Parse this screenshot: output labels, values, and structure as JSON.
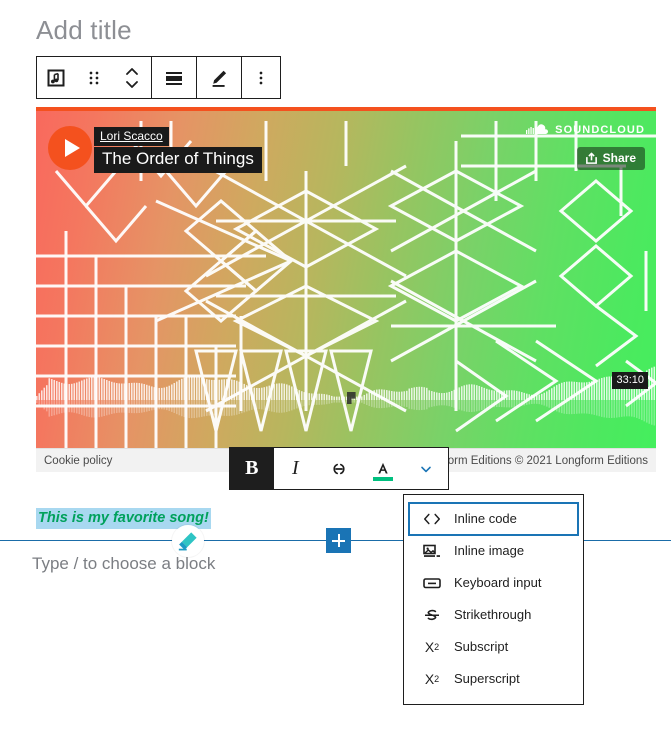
{
  "editor": {
    "title_placeholder": "Add title",
    "block_placeholder": "Type / to choose a block",
    "paragraph_text": "This is my favorite song!"
  },
  "block_toolbar": {
    "items": [
      {
        "name": "audio-block-icon",
        "label": "Audio"
      },
      {
        "name": "drag-handle-icon",
        "label": "Drag"
      },
      {
        "name": "move-updown-icon",
        "label": "Move up or down"
      },
      {
        "name": "align-icon",
        "label": "Change alignment"
      },
      {
        "name": "edit-pencil-icon",
        "label": "Edit"
      },
      {
        "name": "more-options-icon",
        "label": "Options"
      }
    ]
  },
  "embed": {
    "provider": "SOUNDCLOUD",
    "artist": "Lori Scacco",
    "track": "The Order of Things",
    "share_label": "Share",
    "duration": "33:10",
    "cookie_policy": "Cookie policy",
    "copyright": "Longform Editions © 2021 Longform Editions",
    "accent_color": "#f4511e",
    "gradient_start": "#f9695d",
    "gradient_end": "#44ef5d"
  },
  "format_toolbar": {
    "bold_label": "B",
    "italic_label": "I",
    "link_label": "Link",
    "text_color_label": "A",
    "more_label": "More rich text controls",
    "bold_active": true,
    "color_swatch": "#00c07f"
  },
  "dropdown": {
    "items": [
      {
        "icon": "inline-code-icon",
        "label": "Inline code",
        "focused": true
      },
      {
        "icon": "inline-image-icon",
        "label": "Inline image",
        "focused": false
      },
      {
        "icon": "keyboard-input-icon",
        "label": "Keyboard input",
        "focused": false
      },
      {
        "icon": "strikethrough-icon",
        "label": "Strikethrough",
        "focused": false
      },
      {
        "icon": "subscript-icon",
        "label": "Subscript",
        "focused": false
      },
      {
        "icon": "superscript-icon",
        "label": "Superscript",
        "focused": false
      }
    ]
  },
  "inserter": {
    "add_block_label": "+"
  }
}
